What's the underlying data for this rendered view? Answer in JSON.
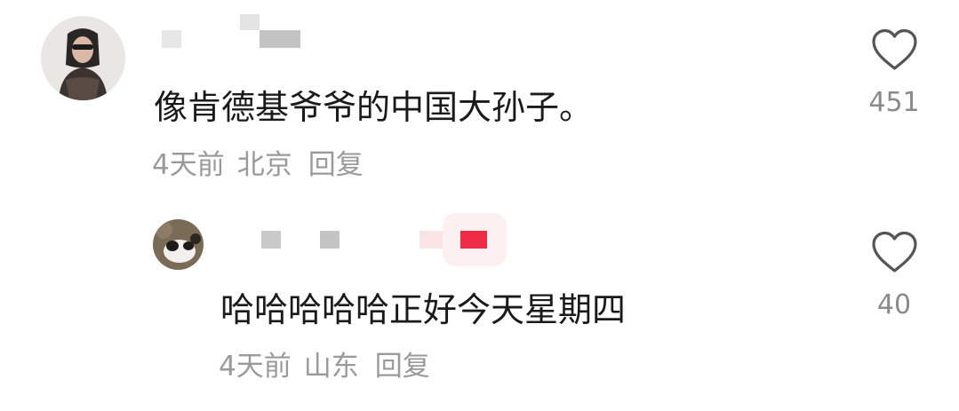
{
  "comments": [
    {
      "text": "像肯德基爷爷的中国大孙子。",
      "time": "4天前",
      "location": "北京",
      "reply_label": "回复",
      "like_count": "451"
    },
    {
      "text": "哈哈哈哈哈正好今天星期四",
      "time": "4天前",
      "location": "山东",
      "reply_label": "回复",
      "like_count": "40"
    }
  ],
  "icons": {
    "like": "heart-outline-icon"
  },
  "colors": {
    "text": "#1a1a1a",
    "meta": "#9a9a9a",
    "count": "#8a8a8a",
    "icon_stroke": "#555555"
  }
}
